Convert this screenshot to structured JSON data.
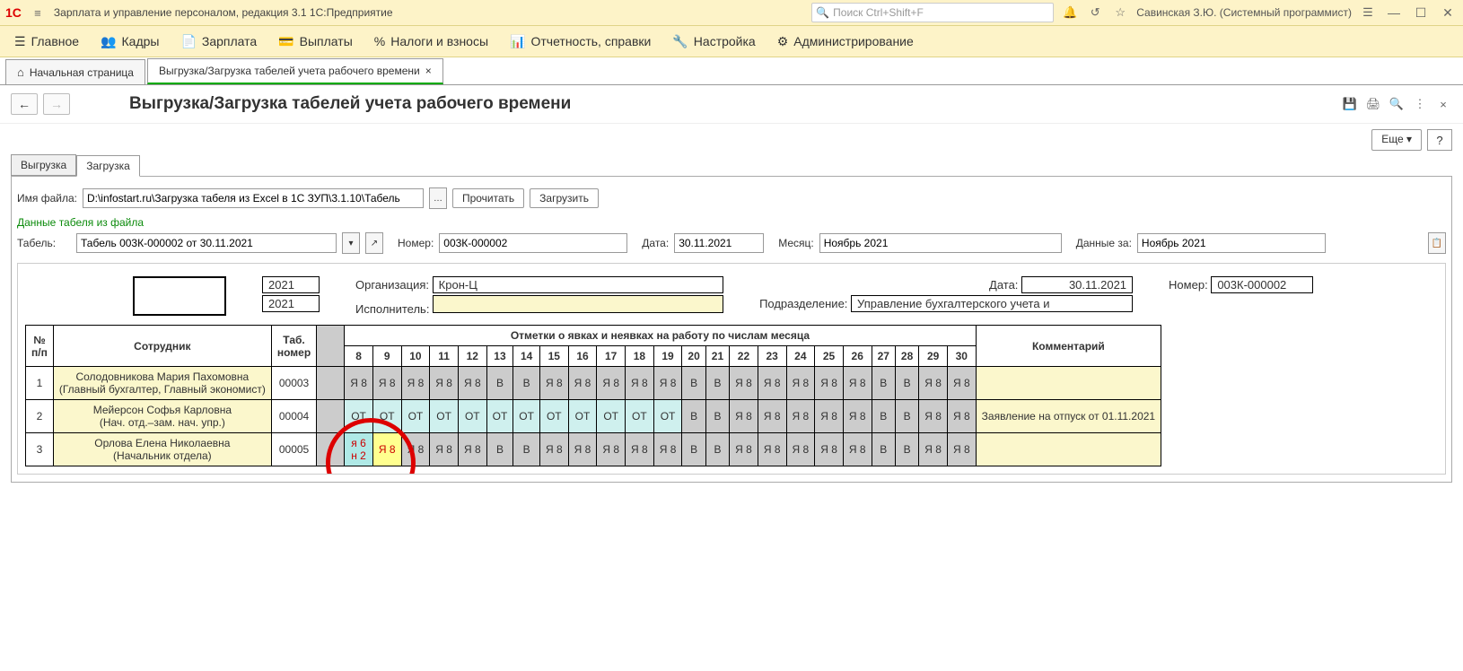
{
  "app": {
    "title": "Зарплата и управление персоналом, редакция 3.1 1С:Предприятие",
    "search_placeholder": "Поиск Ctrl+Shift+F",
    "user": "Савинская З.Ю. (Системный программист)"
  },
  "menu": {
    "main": "Главное",
    "hr": "Кадры",
    "salary": "Зарплата",
    "pay": "Выплаты",
    "taxes": "Налоги и взносы",
    "reports": "Отчетность, справки",
    "setup": "Настройка",
    "admin": "Администрирование"
  },
  "tabs": {
    "home": "Начальная страница",
    "main": "Выгрузка/Загрузка табелей учета рабочего времени"
  },
  "page": {
    "title": "Выгрузка/Загрузка табелей учета рабочего времени",
    "more": "Еще"
  },
  "subtabs": {
    "export": "Выгрузка",
    "import": "Загрузка"
  },
  "file": {
    "label": "Имя файла:",
    "path": "D:\\infostart.ru\\Загрузка табеля из Excel в 1С ЗУП\\3.1.10\\Табель",
    "read": "Прочитать",
    "load": "Загрузить"
  },
  "green": "Данные табеля из файла",
  "form": {
    "tabel_lbl": "Табель:",
    "tabel_val": "Табель 003К-000002 от 30.11.2021",
    "num_lbl": "Номер:",
    "num_val": "003К-000002",
    "date_lbl": "Дата:",
    "date_val": "30.11.2021",
    "month_lbl": "Месяц:",
    "month_val": "Ноябрь 2021",
    "period_lbl": "Данные за:",
    "period_val": "Ноябрь 2021"
  },
  "doc": {
    "y1": "2021",
    "y2": "2021",
    "org_lbl": "Организация:",
    "org_val": "Крон-Ц",
    "exec_lbl": "Исполнитель:",
    "exec_val": "",
    "date_lbl": "Дата:",
    "date_val": "30.11.2021",
    "dept_lbl": "Подразделение:",
    "dept_val": "Управление бухгалтерского учета и",
    "num_lbl": "Номер:",
    "num_val": "003К-000002"
  },
  "grid": {
    "h_num": "№ п/п",
    "h_emp": "Сотрудник",
    "h_tab": "Таб. номер",
    "h_marks": "Отметки о явках и неявках на работу по числам месяца",
    "h_cmt": "Комментарий",
    "days": [
      "8",
      "9",
      "10",
      "11",
      "12",
      "13",
      "14",
      "15",
      "16",
      "17",
      "18",
      "19",
      "20",
      "21",
      "22",
      "23",
      "24",
      "25",
      "26",
      "27",
      "28",
      "29",
      "30"
    ],
    "wkend": [
      5,
      6,
      12,
      13,
      19,
      20
    ],
    "rows": [
      {
        "n": "1",
        "emp": "Солодовникова Мария Пахомовна\n (Главный бухгалтер, Главный экономист)",
        "tn": "00003",
        "cells": [
          "Я 8",
          "Я 8",
          "Я 8",
          "Я 8",
          "Я 8",
          "В",
          "В",
          "Я 8",
          "Я 8",
          "Я 8",
          "Я 8",
          "Я 8",
          "В",
          "В",
          "Я 8",
          "Я 8",
          "Я 8",
          "Я 8",
          "Я 8",
          "В",
          "В",
          "Я 8",
          "Я 8"
        ],
        "style": [
          "gray",
          "gray",
          "gray",
          "gray",
          "gray",
          "gray",
          "gray",
          "gray",
          "gray",
          "gray",
          "gray",
          "gray",
          "gray",
          "gray",
          "gray",
          "gray",
          "gray",
          "gray",
          "gray",
          "gray",
          "gray",
          "gray",
          "gray"
        ],
        "cmt": ""
      },
      {
        "n": "2",
        "emp": "Мейерсон Софья Карловна\n(Нач. отд.–зам. нач. упр.)",
        "tn": "00004",
        "cells": [
          "ОТ",
          "ОТ",
          "ОТ",
          "ОТ",
          "ОТ",
          "ОТ",
          "ОТ",
          "ОТ",
          "ОТ",
          "ОТ",
          "ОТ",
          "ОТ",
          "В",
          "В",
          "Я 8",
          "Я 8",
          "Я 8",
          "Я 8",
          "Я 8",
          "В",
          "В",
          "Я 8",
          "Я 8"
        ],
        "style": [
          "cy",
          "cy",
          "cy",
          "cy",
          "cy",
          "cy",
          "cy",
          "cy",
          "cy",
          "cy",
          "cy",
          "cy",
          "gray",
          "gray",
          "gray",
          "gray",
          "gray",
          "gray",
          "gray",
          "gray",
          "gray",
          "gray",
          "gray"
        ],
        "cmt": "Заявление на отпуск от 01.11.2021"
      },
      {
        "n": "3",
        "emp": "Орлова Елена Николаевна\n(Начальник отдела)",
        "tn": "00005",
        "cells": [
          "я 6\nн 2",
          "Я 8",
          "Я 8",
          "Я 8",
          "Я 8",
          "В",
          "В",
          "Я 8",
          "Я 8",
          "Я 8",
          "Я 8",
          "Я 8",
          "В",
          "В",
          "Я 8",
          "Я 8",
          "Я 8",
          "Я 8",
          "Я 8",
          "В",
          "В",
          "Я 8",
          "Я 8"
        ],
        "style": [
          "wday",
          "yellowfill",
          "gray",
          "gray",
          "gray",
          "gray",
          "gray",
          "gray",
          "gray",
          "gray",
          "gray",
          "gray",
          "gray",
          "gray",
          "gray",
          "gray",
          "gray",
          "gray",
          "gray",
          "gray",
          "gray",
          "gray",
          "gray"
        ],
        "red": [
          true,
          true
        ],
        "cmt": ""
      }
    ]
  }
}
